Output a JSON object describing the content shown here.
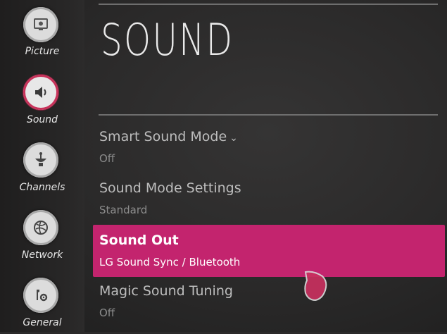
{
  "page": {
    "title": "SOUND"
  },
  "sidebar": {
    "items": [
      {
        "label": "Picture",
        "icon": "picture-icon",
        "active": false
      },
      {
        "label": "Sound",
        "icon": "speaker-icon",
        "active": true
      },
      {
        "label": "Channels",
        "icon": "antenna-icon",
        "active": false
      },
      {
        "label": "Network",
        "icon": "globe-icon",
        "active": false
      },
      {
        "label": "General",
        "icon": "wrench-gear-icon",
        "active": false
      }
    ]
  },
  "menu": {
    "items": [
      {
        "label": "Smart Sound Mode",
        "value": "Off",
        "expandable": true
      },
      {
        "label": "Sound Mode Settings",
        "value": "Standard"
      },
      {
        "label": "Sound Out",
        "value": "LG Sound Sync / Bluetooth",
        "selected": true
      },
      {
        "label": "Magic Sound Tuning",
        "value": "Off"
      }
    ],
    "chevron": "⌄"
  },
  "colors": {
    "accent": "#c3246e",
    "active_ring": "#c8325a",
    "text": "#bdbdbd"
  }
}
